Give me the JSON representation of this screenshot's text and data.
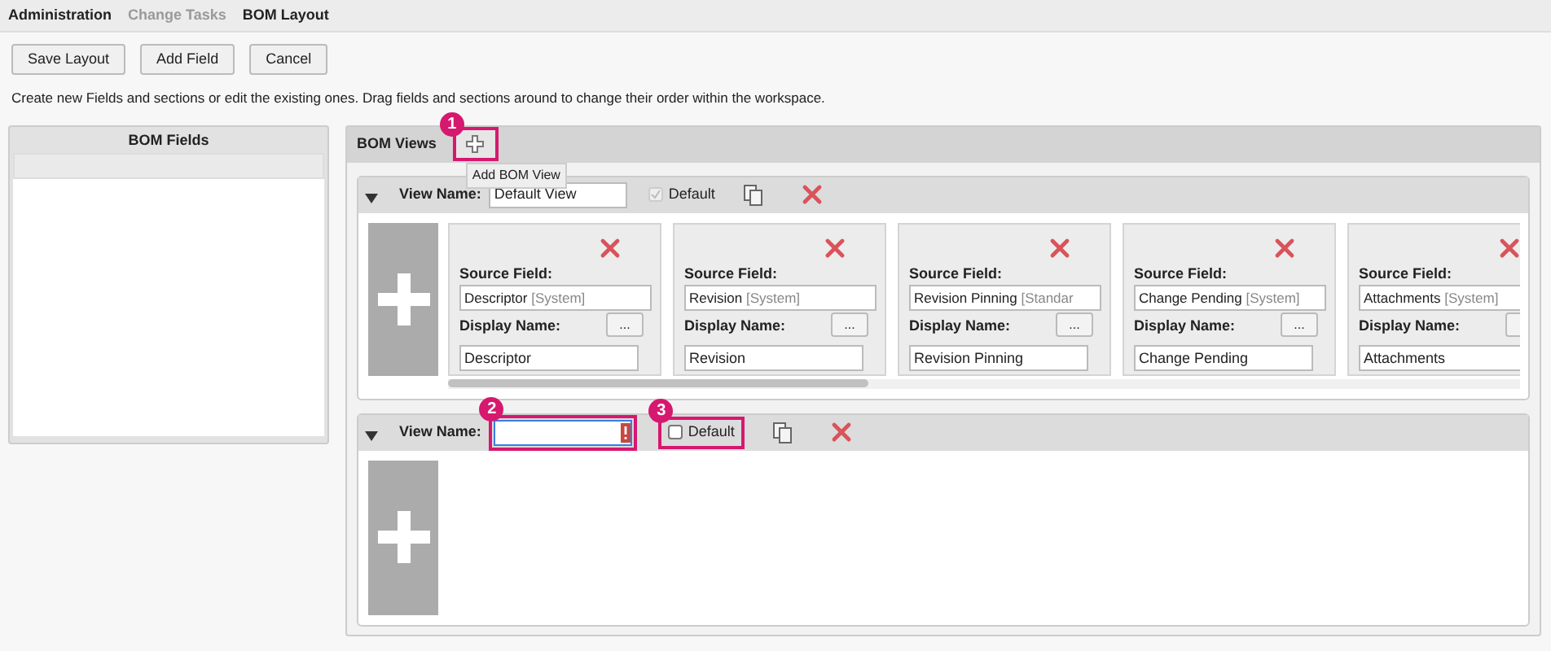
{
  "breadcrumbs": [
    {
      "label": "Administration",
      "disabled": false
    },
    {
      "label": "Change Tasks",
      "disabled": true
    },
    {
      "label": "BOM Layout",
      "disabled": false
    }
  ],
  "buttons": [
    "Save Layout",
    "Add Field",
    "Cancel"
  ],
  "description": "Create new Fields and sections or edit the existing ones. Drag fields and sections around to change their order within the workspace.",
  "bom_fields": {
    "title": "BOM Fields"
  },
  "bom_views": {
    "title": "BOM Views",
    "add_button": {
      "badge": "1",
      "tooltip": "Add BOM View"
    },
    "views": [
      {
        "expanded": true,
        "label": "View Name:",
        "value": "Default View",
        "invalid": false,
        "default_label": "Default",
        "default_checked": true,
        "default_disabled": true,
        "fields": [
          {
            "source_label": "Source Field:",
            "source": "Descriptor",
            "source_tag": "[System]",
            "display_label": "Display Name:",
            "display": "Descriptor",
            "more": "..."
          },
          {
            "source_label": "Source Field:",
            "source": "Revision",
            "source_tag": "[System]",
            "display_label": "Display Name:",
            "display": "Revision",
            "more": "..."
          },
          {
            "source_label": "Source Field:",
            "source": "Revision Pinning",
            "source_tag": "[Standar",
            "display_label": "Display Name:",
            "display": "Revision Pinning",
            "more": "..."
          },
          {
            "source_label": "Source Field:",
            "source": "Change Pending",
            "source_tag": "[System]",
            "display_label": "Display Name:",
            "display": "Change Pending",
            "more": "..."
          },
          {
            "source_label": "Source Field:",
            "source": "Attachments",
            "source_tag": "[System]",
            "display_label": "Display Name:",
            "display": "Attachments"
          }
        ]
      },
      {
        "expanded": true,
        "label": "View Name:",
        "name_badge": "2",
        "invalid": true,
        "default_label": "Default",
        "default_checked": false,
        "default_disabled": false,
        "default_badge": "3"
      }
    ]
  }
}
